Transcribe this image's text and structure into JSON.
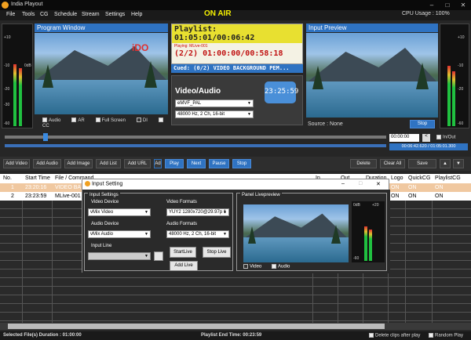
{
  "window": {
    "title": "India Playout",
    "on_air": "ON AIR",
    "cpu": "CPU Usage : 100%"
  },
  "menu": [
    "File",
    "Tools",
    "CG",
    "Schedule",
    "Stream",
    "Settings",
    "Help"
  ],
  "left_vu": {
    "ticks": [
      "+10",
      "0dB",
      "-10",
      "-20",
      "-30",
      "-40",
      "-50",
      "-60"
    ],
    "levels": [
      0.62,
      0.58
    ]
  },
  "right_vu": {
    "ticks": [
      "+10",
      "0dB",
      "-10",
      "-20",
      "-30",
      "-40",
      "-50",
      "-60"
    ],
    "levels": [
      0.6,
      0.55
    ]
  },
  "program": {
    "header": "Program Window",
    "overlay": "iDO",
    "options": [
      {
        "label": "Audio",
        "checked": false
      },
      {
        "label": "AR",
        "checked": false
      },
      {
        "label": "Full Screen",
        "checked": false
      },
      {
        "label": "DI",
        "checked": true
      },
      {
        "label": "CC",
        "checked": false
      }
    ]
  },
  "playlist": {
    "header": "Playlist: 01:05:01/00:06:42",
    "playing_small": "Playing: MLive-001",
    "playing_time": "(2/2) 01:00:00/00:58:18",
    "cued": "Cued: (0/2) VIDEO BACKGROUND PEM..."
  },
  "video_audio": {
    "title": "Video/Audio",
    "video_format": "eMVF_PAL",
    "audio_format": "48000 Hz, 2 Ch, 16-bit",
    "clock": "23:25:59"
  },
  "input_preview": {
    "header": "Input Preview",
    "source": "Source : None",
    "stop": "Stop"
  },
  "timeline": {
    "time": "00:00:00",
    "inout": "In/Out",
    "position": "00:06:42.620 / 01:05:01.300",
    "progress": 0.1
  },
  "toolbar": {
    "add_video": "Add Video",
    "add_audio": "Add Audio",
    "add_image": "Add Image",
    "add_list": "Add List",
    "add_url": "Add URL",
    "add_more": "Ad",
    "play": "Play",
    "next": "Next",
    "pause": "Pause",
    "stop": "Stop",
    "delete": "Delete",
    "clear_all": "Clear All",
    "save": "Save"
  },
  "grid": {
    "columns": [
      "No.",
      "Start Time",
      "File / Command",
      "In",
      "Out",
      "Duration",
      "Logo",
      "QuickCG",
      "PlaylistCG"
    ],
    "rows": [
      [
        "1",
        "23:20:16",
        "VIDEO BA",
        "",
        "",
        "",
        "ON",
        "ON",
        "ON"
      ],
      [
        "2",
        "23:23:59",
        "MLive-001",
        "",
        "",
        "",
        "ON",
        "ON",
        "ON"
      ]
    ]
  },
  "dialog": {
    "title": "Input Setting",
    "group": "Input Settings",
    "video_device_label": "Video Device",
    "video_device": "vMix Video",
    "video_formats_label": "Video Formats",
    "video_format": "YUY2 1280x720@29.97p 1",
    "audio_device_label": "Audio Device",
    "audio_device": "vMix Audio",
    "audio_formats_label": "Audio Formats",
    "audio_format": "48000 Hz, 2 Ch, 16-bit",
    "input_line_label": "Input Line",
    "start_live": "StartLive",
    "stop_live": "Stop Live",
    "add_live": "Add Live",
    "livepreview_label": "Panel Livepreview",
    "video_check": "Video",
    "audio_check": "Audio",
    "meter_ticks": [
      "0dB",
      "+20",
      "-10",
      "-20",
      "-30",
      "-40",
      "-50",
      "-60"
    ]
  },
  "status": {
    "selected": "Selected File(s) Duration : 01:00:00",
    "end_time": "Playlist End Time: 00:23:59",
    "delete_clips": "Delete clips after play",
    "random_play": "Random Play"
  }
}
